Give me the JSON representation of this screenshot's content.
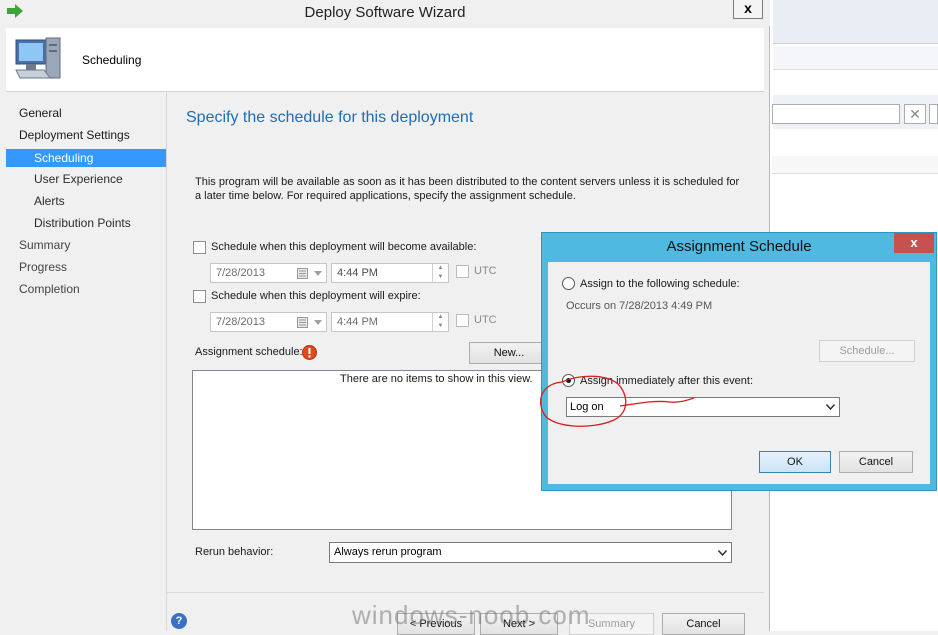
{
  "wizard": {
    "title": "Deploy Software Wizard",
    "close_glyph": "x",
    "header_title": "Scheduling",
    "main_title": "Specify the schedule for this deployment",
    "intro_text": "This program will be available as soon as it has been distributed to the content servers unless it is scheduled for a later time below. For required applications, specify the assignment schedule."
  },
  "nav": {
    "general": "General",
    "deployment_settings": "Deployment Settings",
    "scheduling": "Scheduling",
    "user_experience": "User Experience",
    "alerts": "Alerts",
    "distribution_points": "Distribution Points",
    "summary": "Summary",
    "progress": "Progress",
    "completion": "Completion"
  },
  "schedule": {
    "available_label": "Schedule when this deployment will become available:",
    "available_date": "7/28/2013",
    "available_time": "4:44 PM",
    "expire_label": "Schedule when this deployment will expire:",
    "expire_date": "7/28/2013",
    "expire_time": "4:44 PM",
    "utc_label": "UTC",
    "assignment_label": "Assignment schedule:",
    "new_button": "New...",
    "empty_list": "There are no items to show in this view.",
    "rerun_label": "Rerun behavior:",
    "rerun_value": "Always rerun program"
  },
  "footer": {
    "help_glyph": "?",
    "previous": "< Previous",
    "next": "Next >",
    "summary": "Summary",
    "cancel": "Cancel"
  },
  "dialog": {
    "title": "Assignment Schedule",
    "close_glyph": "x",
    "option1": "Assign to the following schedule:",
    "occurs_text": "Occurs on 7/28/2013 4:49 PM",
    "schedule_button": "Schedule...",
    "option2": "Assign immediately after this event:",
    "event_value": "Log on",
    "ok": "OK",
    "cancel": "Cancel"
  },
  "background": {
    "search_clear_glyph": "✕"
  },
  "watermark": "windows-noob.com",
  "colors": {
    "accent_blue": "#3399ff",
    "title_blue": "#1e6db5",
    "dialog_frame": "#4fb9e0",
    "close_red": "#c75050",
    "annotation_red": "#d62020"
  }
}
